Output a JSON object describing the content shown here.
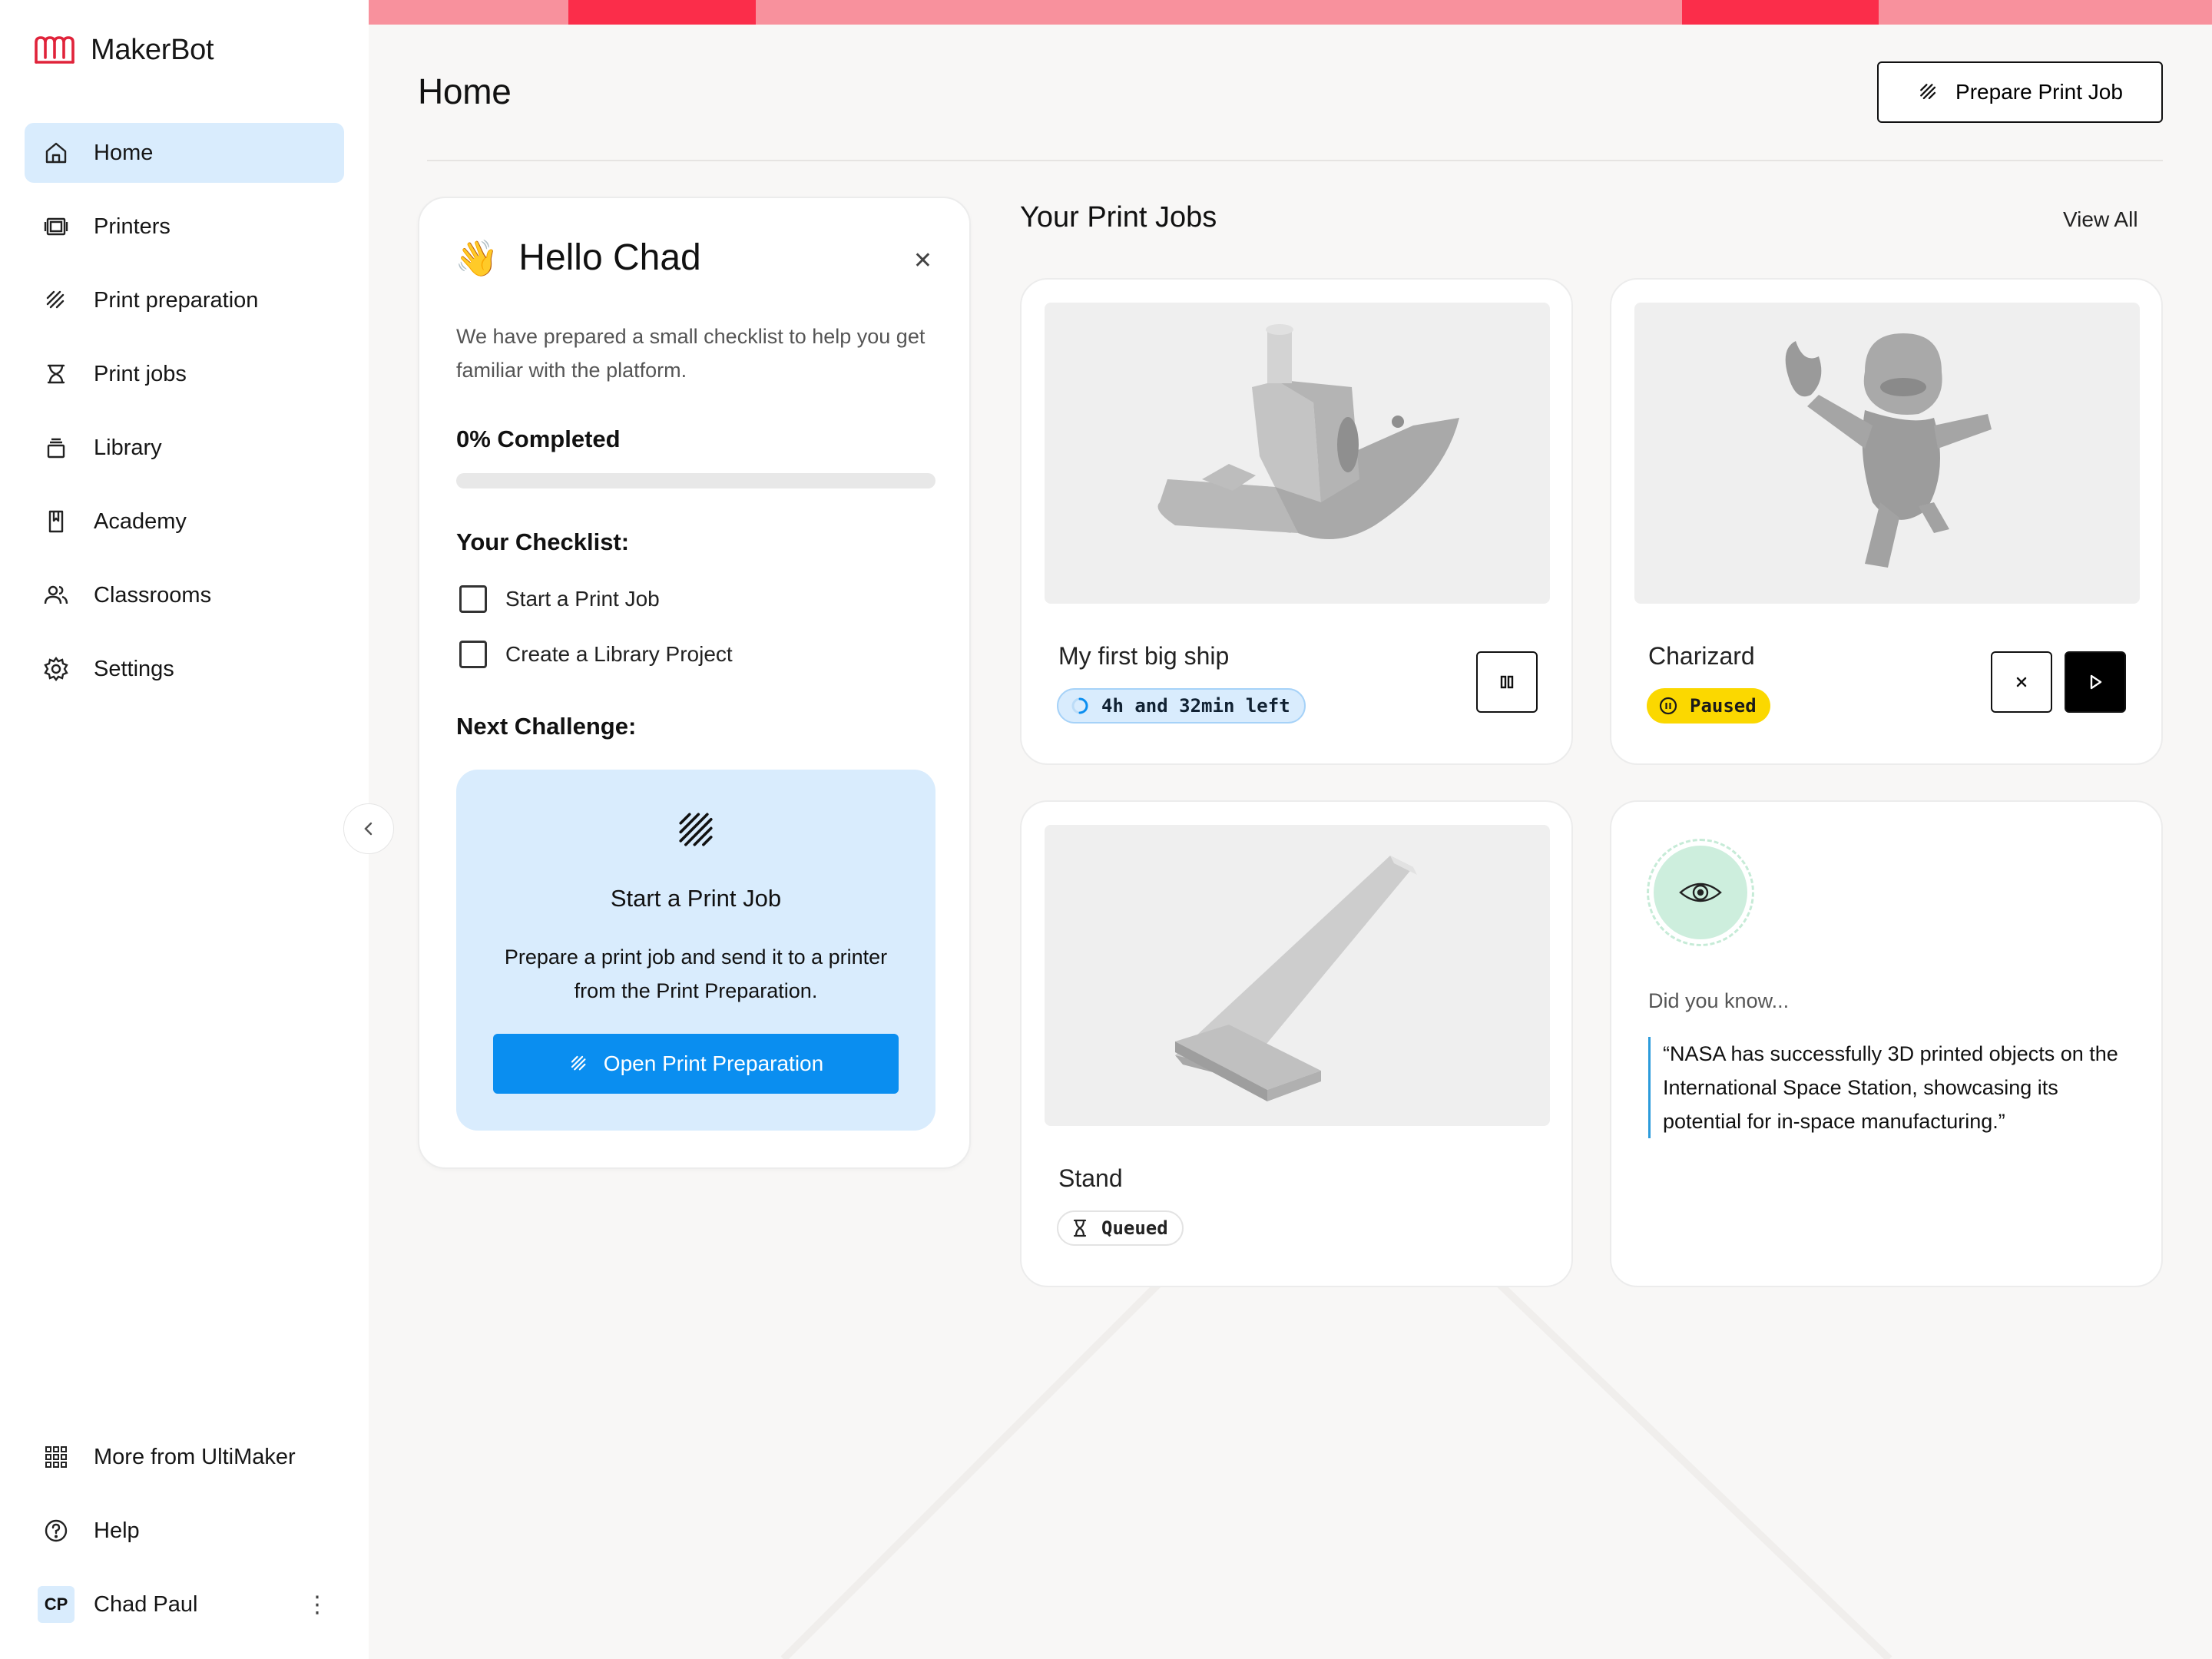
{
  "app": {
    "brand_name": "MakerBot",
    "brand_color": "#e0233a",
    "accent_color": "#0a8ef0"
  },
  "sidebar": {
    "items": [
      {
        "label": "Home",
        "icon": "home-icon",
        "active": true
      },
      {
        "label": "Printers",
        "icon": "printer-icon"
      },
      {
        "label": "Print preparation",
        "icon": "print-prep-icon"
      },
      {
        "label": "Print jobs",
        "icon": "print-jobs-icon"
      },
      {
        "label": "Library",
        "icon": "library-icon"
      },
      {
        "label": "Academy",
        "icon": "academy-icon"
      },
      {
        "label": "Classrooms",
        "icon": "classrooms-icon"
      },
      {
        "label": "Settings",
        "icon": "gear-icon"
      }
    ],
    "bottom": {
      "more_label": "More from UltiMaker",
      "help_label": "Help",
      "user_initials": "CP",
      "user_name": "Chad Paul"
    }
  },
  "header": {
    "title": "Home",
    "prepare_button": "Prepare Print Job"
  },
  "hello_card": {
    "emoji": "👋",
    "title": "Hello Chad",
    "description": "We have prepared a small checklist to help you get familiar with the platform.",
    "progress_label": "0% Completed",
    "progress_fraction": 0,
    "checklist_title": "Your Checklist:",
    "checklist": [
      {
        "label": "Start a Print Job",
        "checked": false
      },
      {
        "label": "Create a Library Project",
        "checked": false
      }
    ],
    "next_title": "Next Challenge:",
    "challenge": {
      "title": "Start a Print Job",
      "description": "Prepare a print job and send it to a printer from the Print Preparation.",
      "button": "Open Print Preparation"
    }
  },
  "jobs": {
    "title": "Your Print Jobs",
    "view_all": "View All",
    "items": [
      {
        "name": "My first big ship",
        "status": "4h and 32min left",
        "status_type": "printing"
      },
      {
        "name": "Charizard",
        "status": "Paused",
        "status_type": "paused"
      },
      {
        "name": "Stand",
        "status": "Queued",
        "status_type": "queued"
      }
    ]
  },
  "fact": {
    "label": "Did you know...",
    "quote": "“NASA has successfully 3D printed objects on the International Space Station, showcasing its potential for in-space manufacturing.”"
  }
}
